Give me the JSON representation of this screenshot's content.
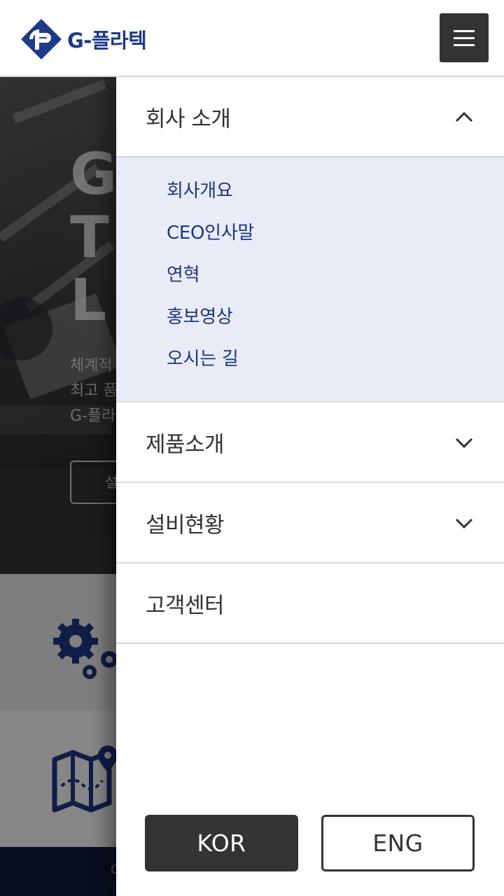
{
  "header": {
    "logo_text": "G-플라텍",
    "menu_icon": "hamburger-icon"
  },
  "hero": {
    "title_fragments": [
      "G",
      "T",
      "L"
    ],
    "desc_fragments": [
      "체계적",
      "최고 품",
      "G-플라"
    ],
    "button_fragment": "설"
  },
  "features": [
    {
      "icon": "gears-icon"
    },
    {
      "icon": "map-location-icon"
    }
  ],
  "footer": {
    "fragment": "C"
  },
  "drawer": {
    "menu": [
      {
        "label": "회사 소개",
        "expanded": true,
        "chevron": "chevron-up-icon",
        "sub_items": [
          "회사개요",
          "CEO인사말",
          "연혁",
          "홍보영상",
          "오시는 길"
        ]
      },
      {
        "label": "제품소개",
        "expanded": false,
        "chevron": "chevron-down-icon"
      },
      {
        "label": "설비현황",
        "expanded": false,
        "chevron": "chevron-down-icon"
      },
      {
        "label": "고객센터",
        "expanded": false
      }
    ],
    "languages": {
      "kor": "KOR",
      "eng": "ENG",
      "active": "KOR"
    }
  },
  "colors": {
    "brand_blue": "#1f3a8a",
    "submenu_bg": "#e9ecf6",
    "submenu_text": "#1d3582",
    "dark": "#333333",
    "footer_navy": "#101b3d"
  }
}
